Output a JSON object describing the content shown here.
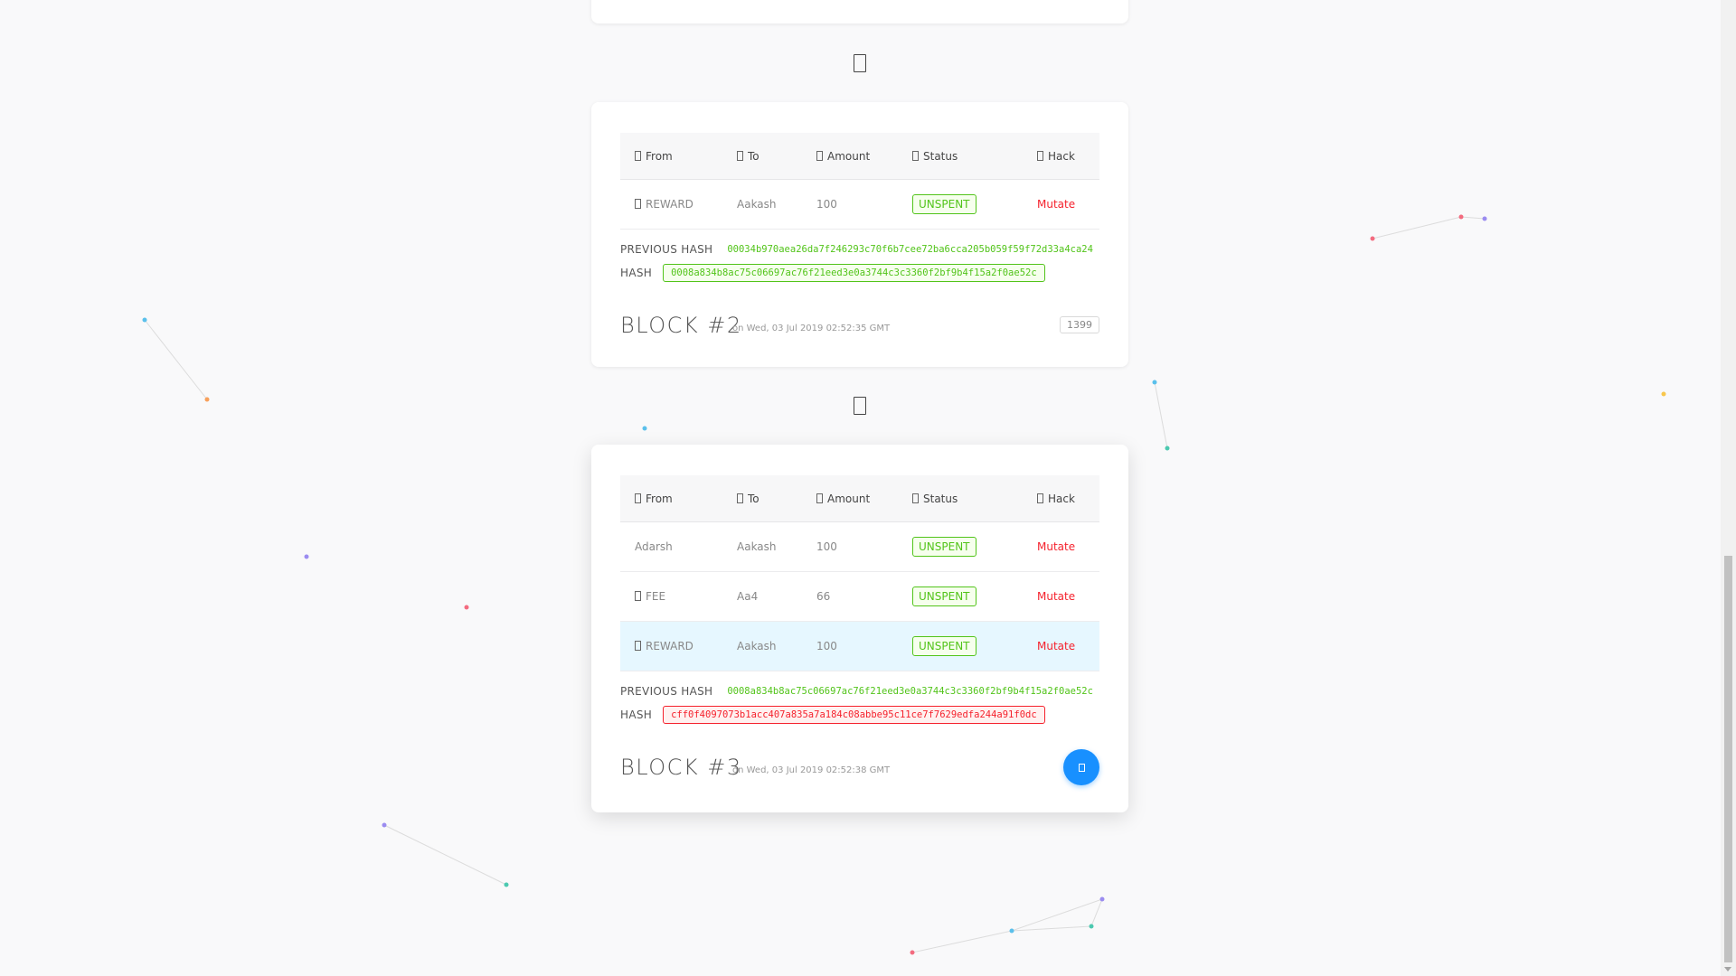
{
  "colors": {
    "accent": "#1890ff",
    "success": "#52c41a",
    "danger": "#f5222d",
    "row_highlight": "#e6f7ff"
  },
  "table_headers": {
    "from": "From",
    "to": "To",
    "amount": "Amount",
    "status": "Status",
    "hack": "Hack"
  },
  "labels": {
    "previous_hash": "PREVIOUS HASH",
    "hash": "HASH"
  },
  "blocks": [
    {
      "title": "BLOCK #2",
      "date": "on Wed, 03 Jul 2019 02:52:35 GMT",
      "nonce": "1399",
      "previous_hash": "00034b970aea26da7f246293c70f6b7cee72ba6cca205b059f59f72d33a4ca24",
      "hash": "0008a834b8ac75c06697ac76f21eed3e0a3744c3c3360f2bf9b4f15a2f0ae52c",
      "hash_valid": true,
      "transactions": [
        {
          "from": "REWARD",
          "to": "Aakash",
          "amount": "100",
          "status": "UNSPENT",
          "hack": "Mutate",
          "from_icon": "gift-icon"
        }
      ]
    },
    {
      "title": "BLOCK #3",
      "date": "on Wed, 03 Jul 2019 02:52:38 GMT",
      "previous_hash": "0008a834b8ac75c06697ac76f21eed3e0a3744c3c3360f2bf9b4f15a2f0ae52c",
      "hash": "cff0f4097073b1acc407a835a7a184c08abbe95c11ce7f7629edfa244a91f0dc",
      "hash_valid": false,
      "transactions": [
        {
          "from": "Adarsh",
          "to": "Aakash",
          "amount": "100",
          "status": "UNSPENT",
          "hack": "Mutate"
        },
        {
          "from": "FEE",
          "to": "Aa4",
          "amount": "66",
          "status": "UNSPENT",
          "hack": "Mutate",
          "from_icon": "fee-icon"
        },
        {
          "from": "REWARD",
          "to": "Aakash",
          "amount": "100",
          "status": "UNSPENT",
          "hack": "Mutate",
          "from_icon": "gift-icon"
        }
      ]
    }
  ]
}
